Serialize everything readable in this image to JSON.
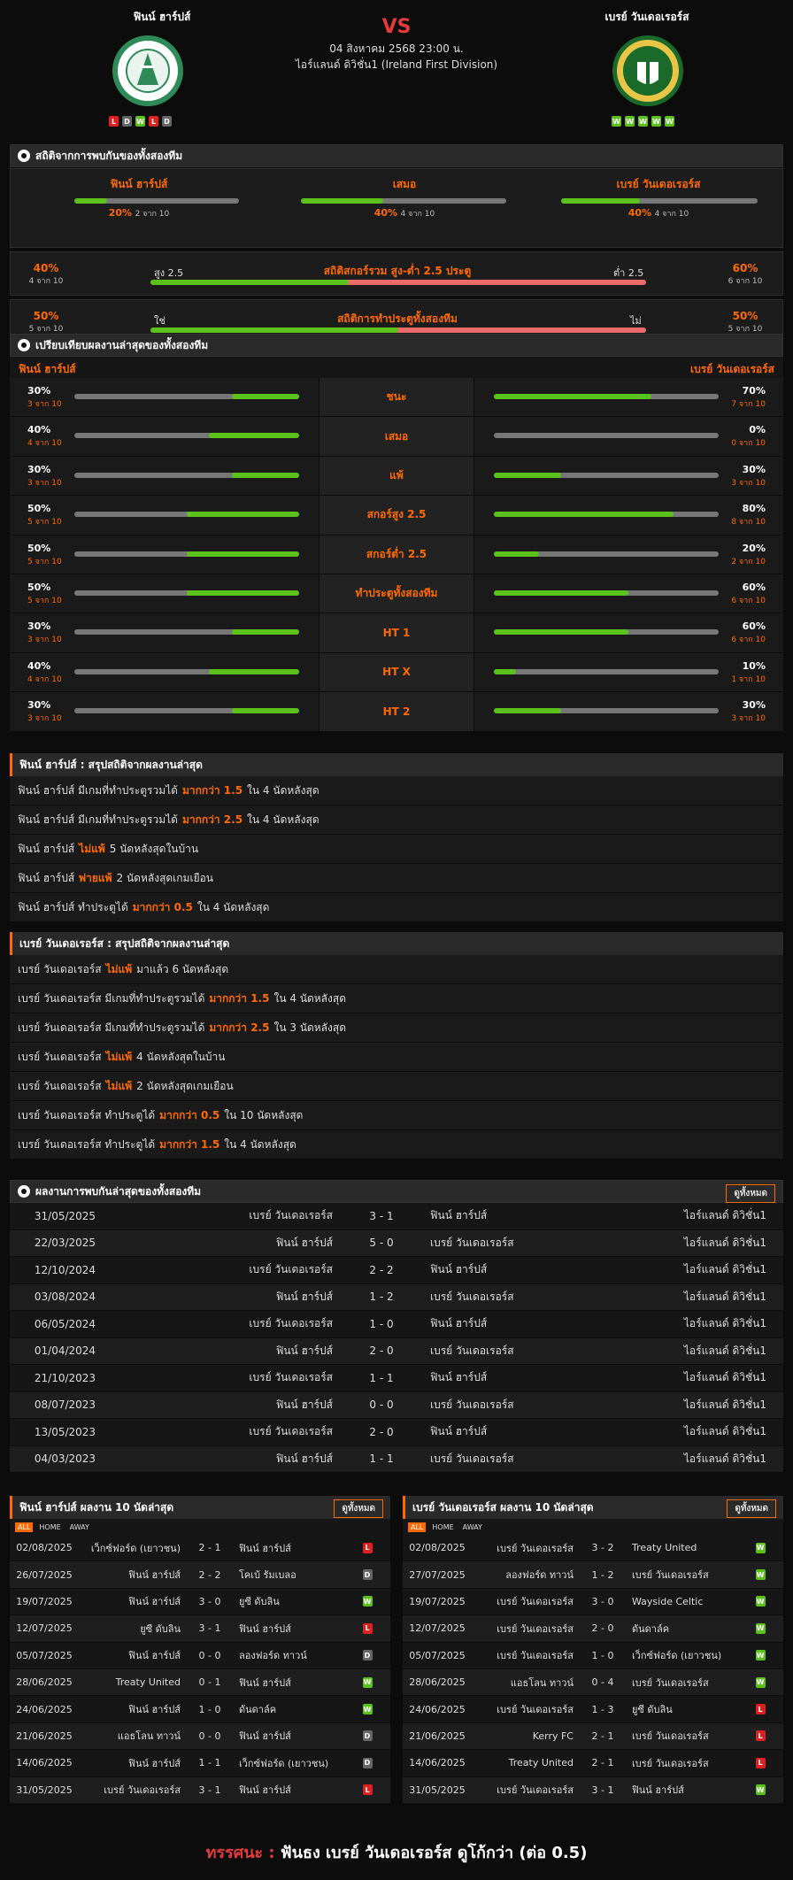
{
  "match": {
    "home": "ฟินน์ ฮาร์ปส์",
    "away": "เบรย์ วันเดอเรอร์ส",
    "vs": "VS",
    "date": "04 สิงหาคม 2568 23:00 น.",
    "league": "ไอร์แลนด์ ดิวิชั่น1 (Ireland First Division)",
    "home_form": [
      "L",
      "D",
      "W",
      "L",
      "D"
    ],
    "away_form": [
      "W",
      "W",
      "W",
      "W",
      "W"
    ],
    "colors": {
      "win": "#5ac21a",
      "loss": "#e02020",
      "draw": "#666666",
      "accent": "#ff6a00",
      "vs": "#e23b3b"
    }
  },
  "h2h_stats": {
    "title": "สถิติจากการพบกันของทั้งสองทีม",
    "home": {
      "label": "ฟินน์ ฮาร์ปส์",
      "pct": "20%",
      "sub": "2 จาก 10",
      "value": 0.2
    },
    "draw": {
      "label": "เสมอ",
      "pct": "40%",
      "sub": "4 จาก 10",
      "value": 0.4
    },
    "away": {
      "label": "เบรย์ วันเดอเรอร์ส",
      "pct": "40%",
      "sub": "4 จาก 10",
      "value": 0.4
    },
    "ou": {
      "title": "สถิติสกอร์รวม สูง-ต่ำ 2.5 ประตู",
      "left_pct": "40%",
      "left_sub": "4 จาก 10",
      "left_label": "สูง 2.5",
      "right_label": "ต่ำ 2.5",
      "right_pct": "60%",
      "right_sub": "6 จาก 10",
      "value": 0.4
    },
    "bts": {
      "title": "สถิติการทำประตูทั้งสองทีม",
      "left_pct": "50%",
      "left_sub": "5 จาก 10",
      "left_label": "ใช่",
      "right_label": "ไม่",
      "right_pct": "50%",
      "right_sub": "5 จาก 10",
      "value": 0.5
    }
  },
  "compare": {
    "title": "เปรียบเทียบผลงานล่าสุดของทั้งสองทีม",
    "home_label": "ฟินน์ ฮาร์ปส์",
    "away_label": "เบรย์ วันเดอเรอร์ส",
    "rows": [
      {
        "label": "ชนะ",
        "hp": "30%",
        "hs": "3 จาก 10",
        "hv": 0.3,
        "ap": "70%",
        "as": "7 จาก 10",
        "av": 0.7
      },
      {
        "label": "เสมอ",
        "hp": "40%",
        "hs": "4 จาก 10",
        "hv": 0.4,
        "ap": "0%",
        "as": "0 จาก 10",
        "av": 0
      },
      {
        "label": "แพ้",
        "hp": "30%",
        "hs": "3 จาก 10",
        "hv": 0.3,
        "ap": "30%",
        "as": "3 จาก 10",
        "av": 0.3
      },
      {
        "label": "สกอร์สูง 2.5",
        "hp": "50%",
        "hs": "5 จาก 10",
        "hv": 0.5,
        "ap": "80%",
        "as": "8 จาก 10",
        "av": 0.8
      },
      {
        "label": "สกอร์ต่ำ 2.5",
        "hp": "50%",
        "hs": "5 จาก 10",
        "hv": 0.5,
        "ap": "20%",
        "as": "2 จาก 10",
        "av": 0.2
      },
      {
        "label": "ทำประตูทั้งสองทีม",
        "hp": "50%",
        "hs": "5 จาก 10",
        "hv": 0.5,
        "ap": "60%",
        "as": "6 จาก 10",
        "av": 0.6
      },
      {
        "label": "HT 1",
        "hp": "30%",
        "hs": "3 จาก 10",
        "hv": 0.3,
        "ap": "60%",
        "as": "6 จาก 10",
        "av": 0.6
      },
      {
        "label": "HT X",
        "hp": "40%",
        "hs": "4 จาก 10",
        "hv": 0.4,
        "ap": "10%",
        "as": "1 จาก 10",
        "av": 0.1
      },
      {
        "label": "HT 2",
        "hp": "30%",
        "hs": "3 จาก 10",
        "hv": 0.3,
        "ap": "30%",
        "as": "3 จาก 10",
        "av": 0.3
      }
    ]
  },
  "home_summary": {
    "title": "ฟินน์ ฮาร์ปส์ : สรุปสถิติจากผลงานล่าสุด",
    "rows": [
      {
        "pre": "ฟินน์ ฮาร์ปส์ มีเกมที่ทำประตูรวมได้",
        "hl": "มากกว่า 1.5",
        "post": "ใน 4 นัดหลังสุด"
      },
      {
        "pre": "ฟินน์ ฮาร์ปส์ มีเกมที่ทำประตูรวมได้",
        "hl": "มากกว่า 2.5",
        "post": "ใน 4 นัดหลังสุด"
      },
      {
        "pre": "ฟินน์ ฮาร์ปส์",
        "hl": "ไม่แพ้",
        "post": "5 นัดหลังสุดในบ้าน"
      },
      {
        "pre": "ฟินน์ ฮาร์ปส์",
        "hl": "พ่ายแพ้",
        "post": "2 นัดหลังสุดเกมเยือน"
      },
      {
        "pre": "ฟินน์ ฮาร์ปส์ ทำประตูได้",
        "hl": "มากกว่า 0.5",
        "post": "ใน 4 นัดหลังสุด"
      }
    ]
  },
  "away_summary": {
    "title": "เบรย์ วันเดอเรอร์ส : สรุปสถิติจากผลงานล่าสุด",
    "rows": [
      {
        "pre": "เบรย์ วันเดอเรอร์ส",
        "hl": "ไม่แพ้",
        "post": "มาแล้ว 6 นัดหลังสุด"
      },
      {
        "pre": "เบรย์ วันเดอเรอร์ส มีเกมที่ทำประตูรวมได้",
        "hl": "มากกว่า 1.5",
        "post": "ใน 4 นัดหลังสุด"
      },
      {
        "pre": "เบรย์ วันเดอเรอร์ส มีเกมที่ทำประตูรวมได้",
        "hl": "มากกว่า 2.5",
        "post": "ใน 3 นัดหลังสุด"
      },
      {
        "pre": "เบรย์ วันเดอเรอร์ส",
        "hl": "ไม่แพ้",
        "post": "4 นัดหลังสุดในบ้าน"
      },
      {
        "pre": "เบรย์ วันเดอเรอร์ส",
        "hl": "ไม่แพ้",
        "post": "2 นัดหลังสุดเกมเยือน"
      },
      {
        "pre": "เบรย์ วันเดอเรอร์ส ทำประตูได้",
        "hl": "มากกว่า 0.5",
        "post": "ใน 10 นัดหลังสุด"
      },
      {
        "pre": "เบรย์ วันเดอเรอร์ส ทำประตูได้",
        "hl": "มากกว่า 1.5",
        "post": "ใน 4 นัดหลังสุด"
      }
    ]
  },
  "h2h": {
    "title": "ผลงานการพบกันล่าสุดของทั้งสองทีม",
    "view_all": "ดูทั้งหมด",
    "rows": [
      {
        "date": "31/05/2025",
        "home": "เบรย์ วันเดอเรอร์ส",
        "score": "3 - 1",
        "away": "ฟินน์ ฮาร์ปส์",
        "league": "ไอร์แลนด์ ดิวิชั่น1"
      },
      {
        "date": "22/03/2025",
        "home": "ฟินน์ ฮาร์ปส์",
        "score": "5 - 0",
        "away": "เบรย์ วันเดอเรอร์ส",
        "league": "ไอร์แลนด์ ดิวิชั่น1"
      },
      {
        "date": "12/10/2024",
        "home": "เบรย์ วันเดอเรอร์ส",
        "score": "2 - 2",
        "away": "ฟินน์ ฮาร์ปส์",
        "league": "ไอร์แลนด์ ดิวิชั่น1"
      },
      {
        "date": "03/08/2024",
        "home": "ฟินน์ ฮาร์ปส์",
        "score": "1 - 2",
        "away": "เบรย์ วันเดอเรอร์ส",
        "league": "ไอร์แลนด์ ดิวิชั่น1"
      },
      {
        "date": "06/05/2024",
        "home": "เบรย์ วันเดอเรอร์ส",
        "score": "1 - 0",
        "away": "ฟินน์ ฮาร์ปส์",
        "league": "ไอร์แลนด์ ดิวิชั่น1"
      },
      {
        "date": "01/04/2024",
        "home": "ฟินน์ ฮาร์ปส์",
        "score": "2 - 0",
        "away": "เบรย์ วันเดอเรอร์ส",
        "league": "ไอร์แลนด์ ดิวิชั่น1"
      },
      {
        "date": "21/10/2023",
        "home": "เบรย์ วันเดอเรอร์ส",
        "score": "1 - 1",
        "away": "ฟินน์ ฮาร์ปส์",
        "league": "ไอร์แลนด์ ดิวิชั่น1"
      },
      {
        "date": "08/07/2023",
        "home": "ฟินน์ ฮาร์ปส์",
        "score": "0 - 0",
        "away": "เบรย์ วันเดอเรอร์ส",
        "league": "ไอร์แลนด์ ดิวิชั่น1"
      },
      {
        "date": "13/05/2023",
        "home": "เบรย์ วันเดอเรอร์ส",
        "score": "2 - 0",
        "away": "ฟินน์ ฮาร์ปส์",
        "league": "ไอร์แลนด์ ดิวิชั่น1"
      },
      {
        "date": "04/03/2023",
        "home": "ฟินน์ ฮาร์ปส์",
        "score": "1 - 1",
        "away": "เบรย์ วันเดอเรอร์ส",
        "league": "ไอร์แลนด์ ดิวิชั่น1"
      }
    ]
  },
  "last10": {
    "tabs": [
      "ALL",
      "HOME",
      "AWAY"
    ],
    "view_all": "ดูทั้งหมด",
    "home": {
      "title": "ฟินน์ ฮาร์ปส์ ผลงาน 10 นัดล่าสุด",
      "rows": [
        {
          "date": "02/08/2025",
          "home": "เว็กซ์ฟอร์ด (เยาวชน)",
          "score": "2 - 1",
          "away": "ฟินน์ ฮาร์ปส์",
          "r": "L"
        },
        {
          "date": "26/07/2025",
          "home": "ฟินน์ ฮาร์ปส์",
          "score": "2 - 2",
          "away": "โคเบ้ รัมเบลอ",
          "r": "D"
        },
        {
          "date": "19/07/2025",
          "home": "ฟินน์ ฮาร์ปส์",
          "score": "3 - 0",
          "away": "ยูซี ดับลิน",
          "r": "W"
        },
        {
          "date": "12/07/2025",
          "home": "ยูซี ดับลิน",
          "score": "3 - 1",
          "away": "ฟินน์ ฮาร์ปส์",
          "r": "L"
        },
        {
          "date": "05/07/2025",
          "home": "ฟินน์ ฮาร์ปส์",
          "score": "0 - 0",
          "away": "ลองฟอร์ด ทาวน์",
          "r": "D"
        },
        {
          "date": "28/06/2025",
          "home": "Treaty United",
          "score": "0 - 1",
          "away": "ฟินน์ ฮาร์ปส์",
          "r": "W"
        },
        {
          "date": "24/06/2025",
          "home": "ฟินน์ ฮาร์ปส์",
          "score": "1 - 0",
          "away": "ดันดาล์ค",
          "r": "W"
        },
        {
          "date": "21/06/2025",
          "home": "แอธโลน ทาวน์",
          "score": "0 - 0",
          "away": "ฟินน์ ฮาร์ปส์",
          "r": "D"
        },
        {
          "date": "14/06/2025",
          "home": "ฟินน์ ฮาร์ปส์",
          "score": "1 - 1",
          "away": "เว็กซ์ฟอร์ด (เยาวชน)",
          "r": "D"
        },
        {
          "date": "31/05/2025",
          "home": "เบรย์ วันเดอเรอร์ส",
          "score": "3 - 1",
          "away": "ฟินน์ ฮาร์ปส์",
          "r": "L"
        }
      ]
    },
    "away": {
      "title": "เบรย์ วันเดอเรอร์ส ผลงาน 10 นัดล่าสุด",
      "rows": [
        {
          "date": "02/08/2025",
          "home": "เบรย์ วันเดอเรอร์ส",
          "score": "3 - 2",
          "away": "Treaty United",
          "r": "W"
        },
        {
          "date": "27/07/2025",
          "home": "ลองฟอร์ด ทาวน์",
          "score": "1 - 2",
          "away": "เบรย์ วันเดอเรอร์ส",
          "r": "W"
        },
        {
          "date": "19/07/2025",
          "home": "เบรย์ วันเดอเรอร์ส",
          "score": "3 - 0",
          "away": "Wayside Celtic",
          "r": "W"
        },
        {
          "date": "12/07/2025",
          "home": "เบรย์ วันเดอเรอร์ส",
          "score": "2 - 0",
          "away": "ดันดาล์ค",
          "r": "W"
        },
        {
          "date": "05/07/2025",
          "home": "เบรย์ วันเดอเรอร์ส",
          "score": "1 - 0",
          "away": "เว็กซ์ฟอร์ด (เยาวชน)",
          "r": "W"
        },
        {
          "date": "28/06/2025",
          "home": "แอธโลน ทาวน์",
          "score": "0 - 4",
          "away": "เบรย์ วันเดอเรอร์ส",
          "r": "W"
        },
        {
          "date": "24/06/2025",
          "home": "เบรย์ วันเดอเรอร์ส",
          "score": "1 - 3",
          "away": "ยูซี ดับลิน",
          "r": "L"
        },
        {
          "date": "21/06/2025",
          "home": "Kerry FC",
          "score": "2 - 1",
          "away": "เบรย์ วันเดอเรอร์ส",
          "r": "L"
        },
        {
          "date": "14/06/2025",
          "home": "Treaty United",
          "score": "2 - 1",
          "away": "เบรย์ วันเดอเรอร์ส",
          "r": "L"
        },
        {
          "date": "31/05/2025",
          "home": "เบรย์ วันเดอเรอร์ส",
          "score": "3 - 1",
          "away": "ฟินน์ ฮาร์ปส์",
          "r": "W"
        }
      ]
    }
  },
  "verdict": {
    "label": "ทรรศนะ :",
    "text": "ฟันธง เบรย์ วันเดอเรอร์ส ดูโก้กว่า (ต่อ 0.5)"
  }
}
